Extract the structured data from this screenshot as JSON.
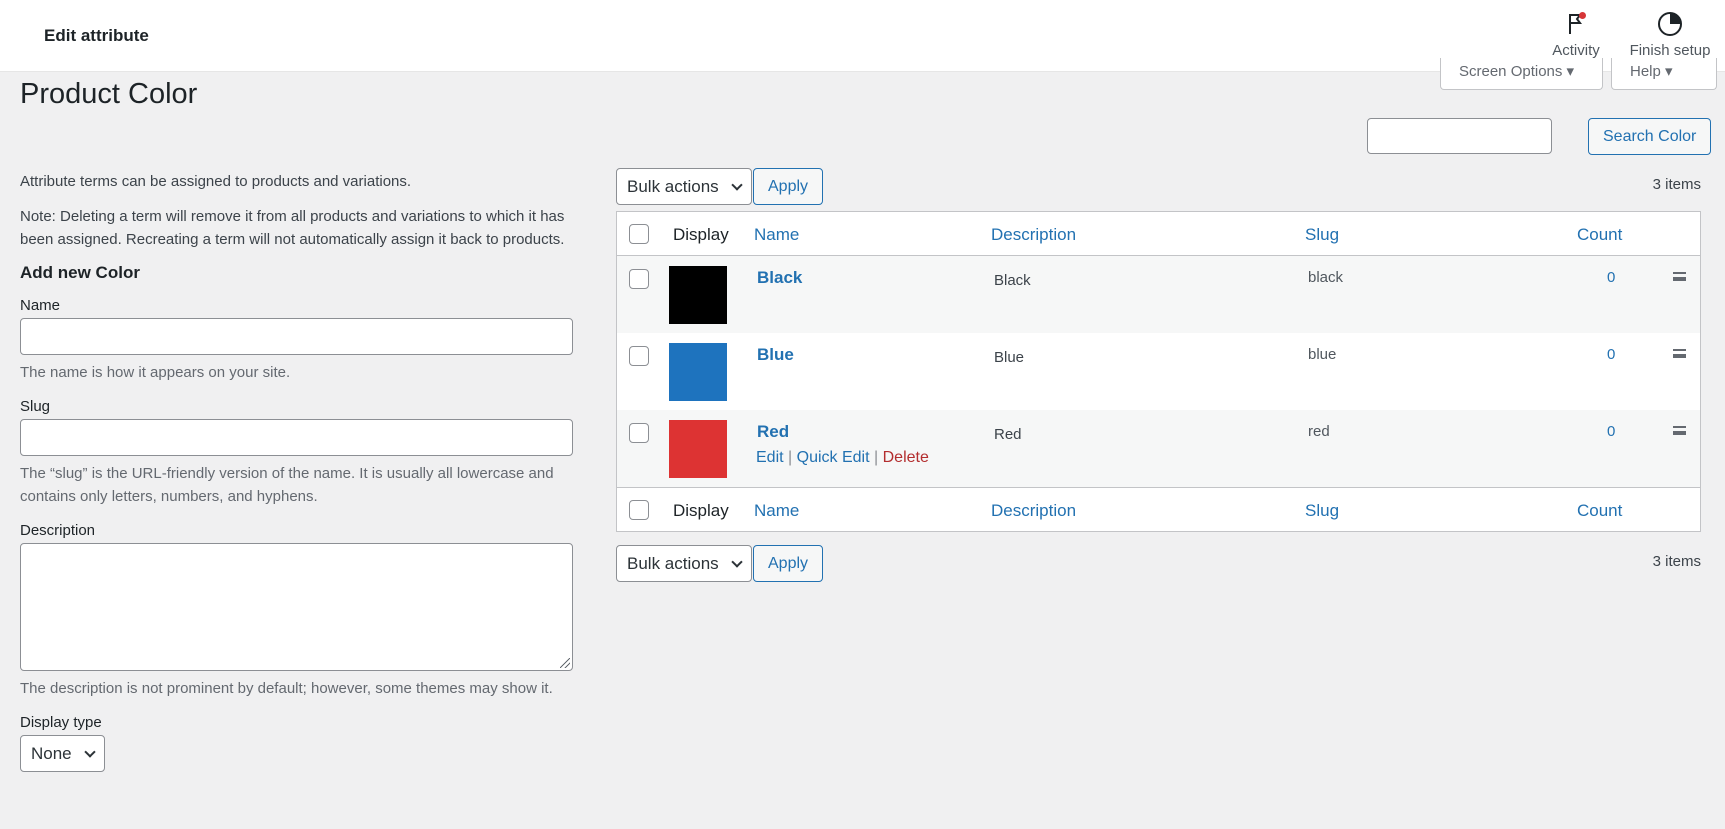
{
  "header": {
    "title": "Edit attribute",
    "activity_label": "Activity",
    "finish_setup_label": "Finish setup"
  },
  "tabs": {
    "screen_options": "Screen Options ▾",
    "help": "Help ▾"
  },
  "page": {
    "title": "Product Color"
  },
  "form": {
    "intro": "Attribute terms can be assigned to products and variations.",
    "note": "Note: Deleting a term will remove it from all products and variations to which it has been assigned. Recreating a term will not automatically assign it back to products.",
    "heading": "Add new Color",
    "name_label": "Name",
    "name_value": "",
    "name_hint": "The name is how it appears on your site.",
    "slug_label": "Slug",
    "slug_value": "",
    "slug_hint": "The “slug” is the URL-friendly version of the name. It is usually all lowercase and contains only letters, numbers, and hyphens.",
    "description_label": "Description",
    "description_hint": "The description is not prominent by default; however, some themes may show it.",
    "display_type_label": "Display type",
    "display_type_value": "None"
  },
  "search": {
    "value": "",
    "button": "Search Color"
  },
  "bulk": {
    "label": "Bulk actions",
    "apply": "Apply",
    "items_count": "3 items"
  },
  "table": {
    "columns": {
      "display": "Display",
      "name": "Name",
      "description": "Description",
      "slug": "Slug",
      "count": "Count"
    },
    "rows": [
      {
        "name": "Black",
        "description": "Black",
        "slug": "black",
        "count": "0",
        "color": "#000000"
      },
      {
        "name": "Blue",
        "description": "Blue",
        "slug": "blue",
        "count": "0",
        "color": "#1e73be"
      },
      {
        "name": "Red",
        "description": "Red",
        "slug": "red",
        "count": "0",
        "color": "#dd3333"
      }
    ],
    "row_actions": {
      "edit": "Edit",
      "quick_edit": "Quick Edit",
      "delete": "Delete",
      "separator": "|"
    }
  },
  "icons": {
    "activity": "flag-icon",
    "finish_setup": "progress-circle-icon",
    "row_handle": "drag-handle-icon"
  },
  "colors": {
    "accent": "#2271b1",
    "danger": "#b32d2e",
    "background": "#f0f0f1"
  }
}
